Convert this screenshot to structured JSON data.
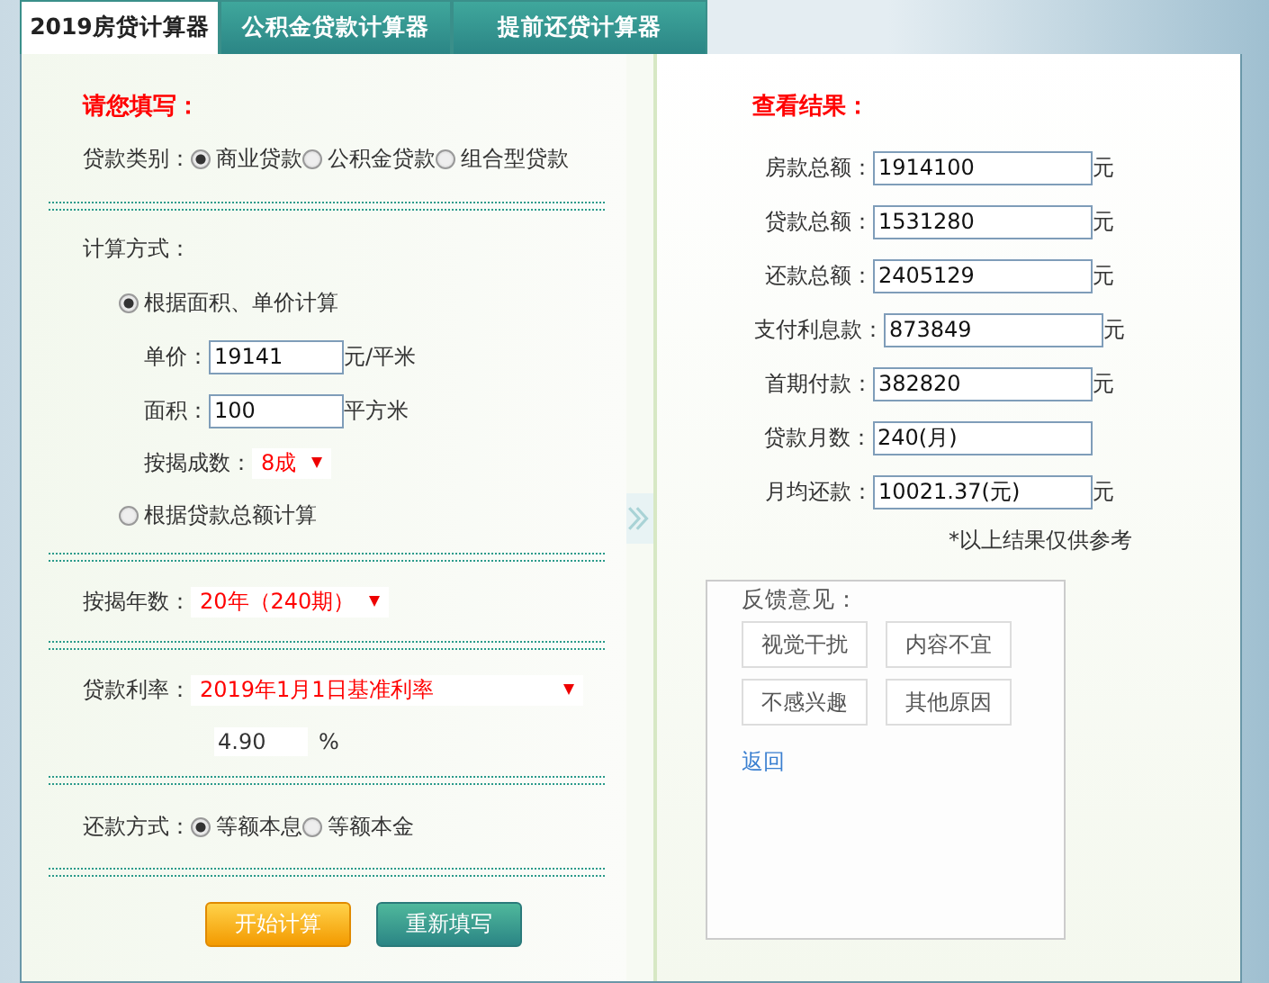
{
  "tabs": [
    {
      "label": "2019房贷计算器",
      "selected": true
    },
    {
      "label": "公积金贷款计算器",
      "selected": false
    },
    {
      "label": "提前还贷计算器",
      "selected": false
    }
  ],
  "form": {
    "heading": "请您填写：",
    "loan_type": {
      "label": "贷款类别：",
      "options": [
        {
          "label": "商业贷款",
          "selected": true
        },
        {
          "label": "公积金贷款",
          "selected": false
        },
        {
          "label": "组合型贷款",
          "selected": false
        }
      ]
    },
    "calc_method": {
      "label": "计算方式：",
      "options": [
        {
          "label": "根据面积、单价计算",
          "selected": true,
          "fields": [
            {
              "kind": "input",
              "label": "单价：",
              "value": "19141",
              "unit": "元/平米"
            },
            {
              "kind": "input",
              "label": "面积：",
              "value": "100",
              "unit": "平方米"
            },
            {
              "kind": "select",
              "label": "按揭成数：",
              "value": "8成"
            }
          ]
        },
        {
          "label": "根据贷款总额计算",
          "selected": false
        }
      ]
    },
    "years": {
      "label": "按揭年数：",
      "value": "20年（240期）"
    },
    "rate": {
      "label": "贷款利率：",
      "value": "2019年1月1日基准利率",
      "rate_value": "4.90",
      "unit": "%"
    },
    "repayment": {
      "label": "还款方式：",
      "options": [
        {
          "label": "等额本息",
          "selected": true
        },
        {
          "label": "等额本金",
          "selected": false
        }
      ]
    },
    "buttons": [
      {
        "label": "开始计算",
        "kind": "primary"
      },
      {
        "label": "重新填写",
        "kind": "secondary"
      }
    ]
  },
  "results": {
    "heading": "查看结果：",
    "rows": [
      {
        "label": "房款总额：",
        "value": "1914100",
        "unit": "元"
      },
      {
        "label": "贷款总额：",
        "value": "1531280",
        "unit": "元"
      },
      {
        "label": "还款总额：",
        "value": "2405129",
        "unit": "元"
      },
      {
        "label": "支付利息款：",
        "value": "873849",
        "unit": "元"
      },
      {
        "label": "首期付款：",
        "value": "382820",
        "unit": "元"
      },
      {
        "label": "贷款月数：",
        "value": "240(月)"
      },
      {
        "label": "月均还款：",
        "value": "10021.37(元)",
        "unit": "元"
      }
    ],
    "note": "*以上结果仅供参考"
  },
  "feedback": {
    "title": "反馈意见：",
    "options": [
      "视觉干扰",
      "内容不宜",
      "不感兴趣",
      "其他原因"
    ],
    "back_link": "返回"
  }
}
